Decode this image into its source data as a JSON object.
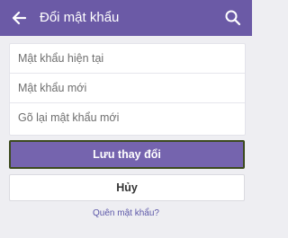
{
  "header": {
    "title": "Đổi mật khẩu",
    "back_icon": "arrow-left-icon",
    "search_icon": "search-icon",
    "background_color": "#6b5aa6"
  },
  "form": {
    "fields": [
      {
        "placeholder": "Mật khẩu hiện tại"
      },
      {
        "placeholder": "Mật khẩu mới"
      },
      {
        "placeholder": "Gõ lại mật khẩu mới"
      }
    ]
  },
  "actions": {
    "save_label": "Lưu thay đổi",
    "cancel_label": "Hủy",
    "forgot_password_label": "Quên mật khẩu?"
  }
}
